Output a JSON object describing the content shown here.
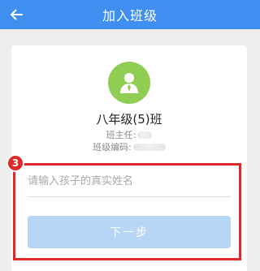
{
  "header": {
    "title": "加入班级",
    "back_icon": "arrow-left-icon"
  },
  "class_info": {
    "name": "八年级(5)班",
    "teacher_label": "班主任:",
    "code_label": "班级编码:",
    "avatar_icon": "person-avatar-icon"
  },
  "form": {
    "step_number": "3",
    "name_placeholder": "请输入孩子的真实姓名",
    "name_value": "",
    "next_label": "下一步"
  },
  "colors": {
    "accent": "#3f8ff0",
    "highlight": "#e02a2a",
    "avatar_bg": "#8fce53",
    "button_disabled": "#b7d6f5"
  }
}
